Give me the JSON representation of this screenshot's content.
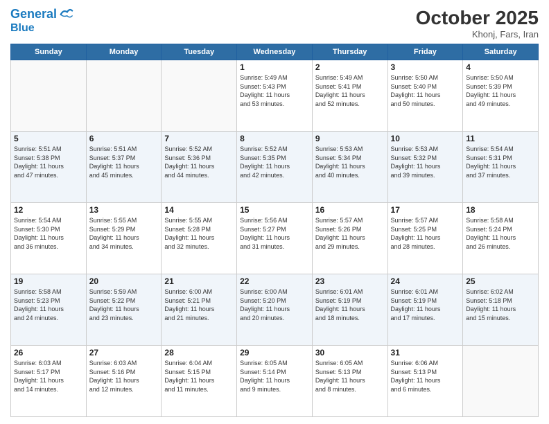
{
  "header": {
    "logo_line1": "General",
    "logo_line2": "Blue",
    "title": "October 2025",
    "location": "Khonj, Fars, Iran"
  },
  "weekdays": [
    "Sunday",
    "Monday",
    "Tuesday",
    "Wednesday",
    "Thursday",
    "Friday",
    "Saturday"
  ],
  "weeks": [
    [
      {
        "day": "",
        "info": ""
      },
      {
        "day": "",
        "info": ""
      },
      {
        "day": "",
        "info": ""
      },
      {
        "day": "1",
        "info": "Sunrise: 5:49 AM\nSunset: 5:43 PM\nDaylight: 11 hours\nand 53 minutes."
      },
      {
        "day": "2",
        "info": "Sunrise: 5:49 AM\nSunset: 5:41 PM\nDaylight: 11 hours\nand 52 minutes."
      },
      {
        "day": "3",
        "info": "Sunrise: 5:50 AM\nSunset: 5:40 PM\nDaylight: 11 hours\nand 50 minutes."
      },
      {
        "day": "4",
        "info": "Sunrise: 5:50 AM\nSunset: 5:39 PM\nDaylight: 11 hours\nand 49 minutes."
      }
    ],
    [
      {
        "day": "5",
        "info": "Sunrise: 5:51 AM\nSunset: 5:38 PM\nDaylight: 11 hours\nand 47 minutes."
      },
      {
        "day": "6",
        "info": "Sunrise: 5:51 AM\nSunset: 5:37 PM\nDaylight: 11 hours\nand 45 minutes."
      },
      {
        "day": "7",
        "info": "Sunrise: 5:52 AM\nSunset: 5:36 PM\nDaylight: 11 hours\nand 44 minutes."
      },
      {
        "day": "8",
        "info": "Sunrise: 5:52 AM\nSunset: 5:35 PM\nDaylight: 11 hours\nand 42 minutes."
      },
      {
        "day": "9",
        "info": "Sunrise: 5:53 AM\nSunset: 5:34 PM\nDaylight: 11 hours\nand 40 minutes."
      },
      {
        "day": "10",
        "info": "Sunrise: 5:53 AM\nSunset: 5:32 PM\nDaylight: 11 hours\nand 39 minutes."
      },
      {
        "day": "11",
        "info": "Sunrise: 5:54 AM\nSunset: 5:31 PM\nDaylight: 11 hours\nand 37 minutes."
      }
    ],
    [
      {
        "day": "12",
        "info": "Sunrise: 5:54 AM\nSunset: 5:30 PM\nDaylight: 11 hours\nand 36 minutes."
      },
      {
        "day": "13",
        "info": "Sunrise: 5:55 AM\nSunset: 5:29 PM\nDaylight: 11 hours\nand 34 minutes."
      },
      {
        "day": "14",
        "info": "Sunrise: 5:55 AM\nSunset: 5:28 PM\nDaylight: 11 hours\nand 32 minutes."
      },
      {
        "day": "15",
        "info": "Sunrise: 5:56 AM\nSunset: 5:27 PM\nDaylight: 11 hours\nand 31 minutes."
      },
      {
        "day": "16",
        "info": "Sunrise: 5:57 AM\nSunset: 5:26 PM\nDaylight: 11 hours\nand 29 minutes."
      },
      {
        "day": "17",
        "info": "Sunrise: 5:57 AM\nSunset: 5:25 PM\nDaylight: 11 hours\nand 28 minutes."
      },
      {
        "day": "18",
        "info": "Sunrise: 5:58 AM\nSunset: 5:24 PM\nDaylight: 11 hours\nand 26 minutes."
      }
    ],
    [
      {
        "day": "19",
        "info": "Sunrise: 5:58 AM\nSunset: 5:23 PM\nDaylight: 11 hours\nand 24 minutes."
      },
      {
        "day": "20",
        "info": "Sunrise: 5:59 AM\nSunset: 5:22 PM\nDaylight: 11 hours\nand 23 minutes."
      },
      {
        "day": "21",
        "info": "Sunrise: 6:00 AM\nSunset: 5:21 PM\nDaylight: 11 hours\nand 21 minutes."
      },
      {
        "day": "22",
        "info": "Sunrise: 6:00 AM\nSunset: 5:20 PM\nDaylight: 11 hours\nand 20 minutes."
      },
      {
        "day": "23",
        "info": "Sunrise: 6:01 AM\nSunset: 5:19 PM\nDaylight: 11 hours\nand 18 minutes."
      },
      {
        "day": "24",
        "info": "Sunrise: 6:01 AM\nSunset: 5:19 PM\nDaylight: 11 hours\nand 17 minutes."
      },
      {
        "day": "25",
        "info": "Sunrise: 6:02 AM\nSunset: 5:18 PM\nDaylight: 11 hours\nand 15 minutes."
      }
    ],
    [
      {
        "day": "26",
        "info": "Sunrise: 6:03 AM\nSunset: 5:17 PM\nDaylight: 11 hours\nand 14 minutes."
      },
      {
        "day": "27",
        "info": "Sunrise: 6:03 AM\nSunset: 5:16 PM\nDaylight: 11 hours\nand 12 minutes."
      },
      {
        "day": "28",
        "info": "Sunrise: 6:04 AM\nSunset: 5:15 PM\nDaylight: 11 hours\nand 11 minutes."
      },
      {
        "day": "29",
        "info": "Sunrise: 6:05 AM\nSunset: 5:14 PM\nDaylight: 11 hours\nand 9 minutes."
      },
      {
        "day": "30",
        "info": "Sunrise: 6:05 AM\nSunset: 5:13 PM\nDaylight: 11 hours\nand 8 minutes."
      },
      {
        "day": "31",
        "info": "Sunrise: 6:06 AM\nSunset: 5:13 PM\nDaylight: 11 hours\nand 6 minutes."
      },
      {
        "day": "",
        "info": ""
      }
    ]
  ]
}
